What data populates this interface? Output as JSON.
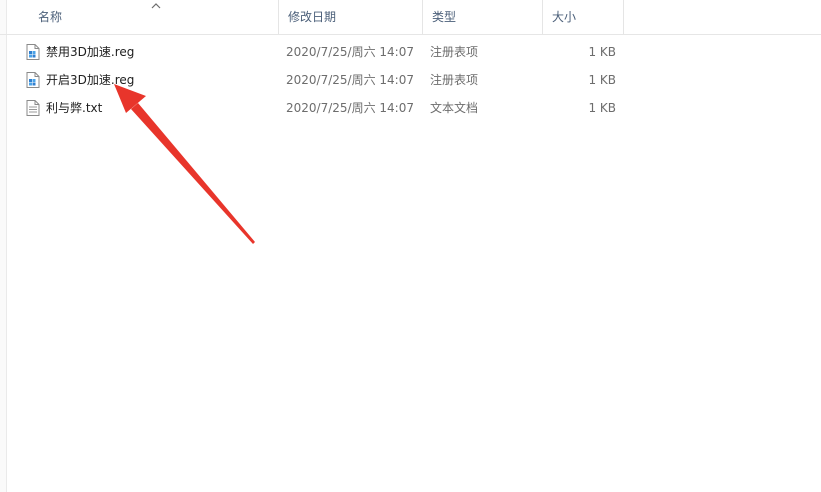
{
  "columns": {
    "name": "名称",
    "date": "修改日期",
    "type": "类型",
    "size": "大小"
  },
  "files": [
    {
      "name": "禁用3D加速.reg",
      "date": "2020/7/25/周六 14:07",
      "type": "注册表项",
      "size": "1 KB",
      "icon": "registry-file-icon"
    },
    {
      "name": "开启3D加速.reg",
      "date": "2020/7/25/周六 14:07",
      "type": "注册表项",
      "size": "1 KB",
      "icon": "registry-file-icon"
    },
    {
      "name": "利与弊.txt",
      "date": "2020/7/25/周六 14:07",
      "type": "文本文档",
      "size": "1 KB",
      "icon": "text-file-icon"
    }
  ],
  "annotation_color": "#e8352b"
}
